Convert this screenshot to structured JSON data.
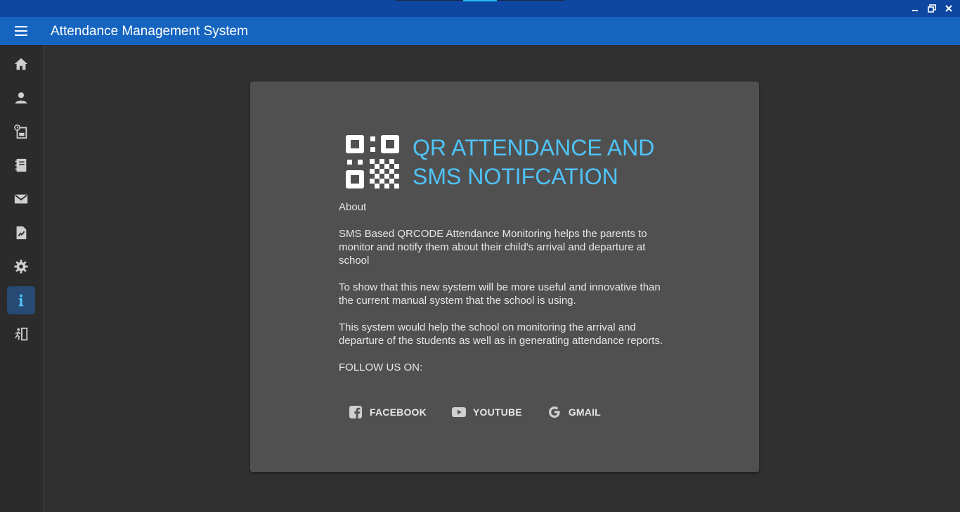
{
  "window": {
    "title": "Attendance Management System"
  },
  "sidebar": {
    "items": [
      {
        "icon": "home-icon",
        "active": false
      },
      {
        "icon": "user-icon",
        "active": false
      },
      {
        "icon": "attendance-log-icon",
        "active": false
      },
      {
        "icon": "notebook-icon",
        "active": false
      },
      {
        "icon": "mail-icon",
        "active": false
      },
      {
        "icon": "report-icon",
        "active": false
      },
      {
        "icon": "gear-icon",
        "active": false
      },
      {
        "icon": "info-icon",
        "active": true
      },
      {
        "icon": "exit-icon",
        "active": false
      }
    ]
  },
  "about": {
    "headline_line1": "QR ATTENDANCE AND",
    "headline_line2": "SMS NOTIFCATION",
    "section_label": "About",
    "paragraphs": [
      "SMS Based QRCODE Attendance Monitoring helps the parents to monitor and notify them about their child's arrival and departure at school",
      "To show that this new system will be more useful and innovative than the current manual system that the school is using.",
      "This system would help the school on monitoring the arrival and departure of the students as well as in generating attendance reports."
    ],
    "follow_label": "FOLLOW US ON:",
    "social": {
      "facebook": "FACEBOOK",
      "youtube": "YOUTUBE",
      "gmail": "GMAIL"
    }
  },
  "colors": {
    "titlebar": "#0d47a1",
    "appbar": "#1565c0",
    "accent": "#4fc3f7",
    "active_nav": "#264a73",
    "card": "#505050",
    "background": "#303030"
  }
}
